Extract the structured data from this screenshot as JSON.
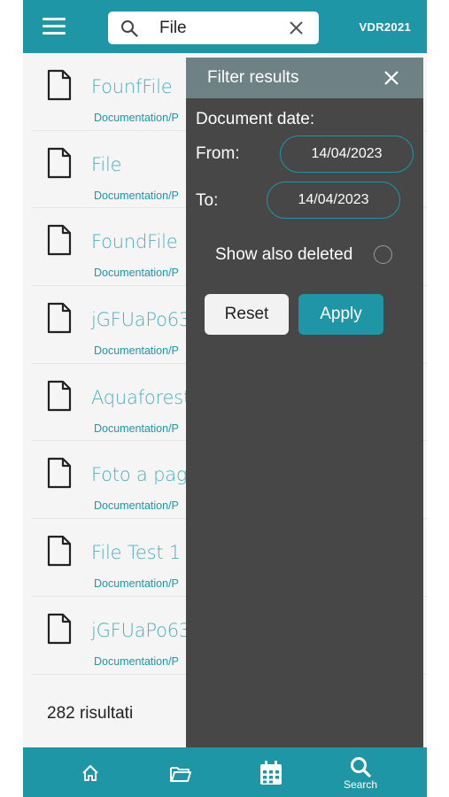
{
  "header": {
    "search_value": "File",
    "brand": "VDR2021"
  },
  "list": {
    "items": [
      {
        "title": "FounfFile",
        "path": "Documentation/P"
      },
      {
        "title": "File",
        "path": "Documentation/P"
      },
      {
        "title": "FoundFile",
        "path": "Documentation/P"
      },
      {
        "title": "jGFUaPo63",
        "path": "Documentation/P"
      },
      {
        "title": "Aquaforest",
        "path": "Documentation/P"
      },
      {
        "title": "Foto a pagin",
        "path": "Documentation/P"
      },
      {
        "title": "File Test 1",
        "path": "Documentation/P"
      },
      {
        "title": "jGFUaPo63",
        "path": "Documentation/P"
      }
    ],
    "results_count": "282 risultati"
  },
  "filter": {
    "title": "Filter results",
    "document_date_label": "Document date:",
    "from_label": "From:",
    "from_value": "14/04/2023",
    "to_label": "To:",
    "to_value": "14/04/2023",
    "show_deleted_label": "Show also deleted",
    "show_deleted_checked": false,
    "reset_label": "Reset",
    "apply_label": "Apply"
  },
  "tabbar": {
    "search_label": "Search"
  },
  "colors": {
    "accent": "#1f96a6",
    "panel_bg": "#474747",
    "panel_header": "#6e8286",
    "link_text": "#4ab0be"
  }
}
